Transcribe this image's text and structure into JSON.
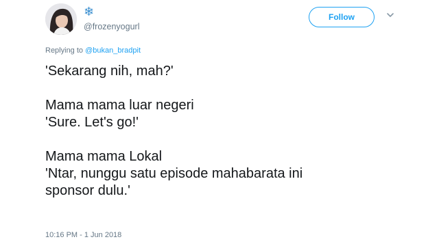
{
  "header": {
    "display_name": "❄",
    "handle": "@frozenyogurl",
    "follow_label": "Follow"
  },
  "reply": {
    "prefix": "Replying to",
    "mention": "@bukan_bradpit"
  },
  "tweet": {
    "lines": [
      "'Sekarang nih, mah?'",
      "",
      "Mama mama luar negeri",
      "'Sure. Let's go!'",
      "",
      "Mama mama Lokal",
      "'Ntar, nunggu satu episode mahabarata ini",
      "sponsor dulu.'"
    ]
  },
  "timestamp": "10:16 PM - 1 Jun 2018",
  "colors": {
    "accent": "#1da1f2",
    "secondary_text": "#657786",
    "primary_text": "#14171a"
  },
  "icons": {
    "chevron": "chevron-down-icon",
    "avatar": "profile-photo"
  }
}
